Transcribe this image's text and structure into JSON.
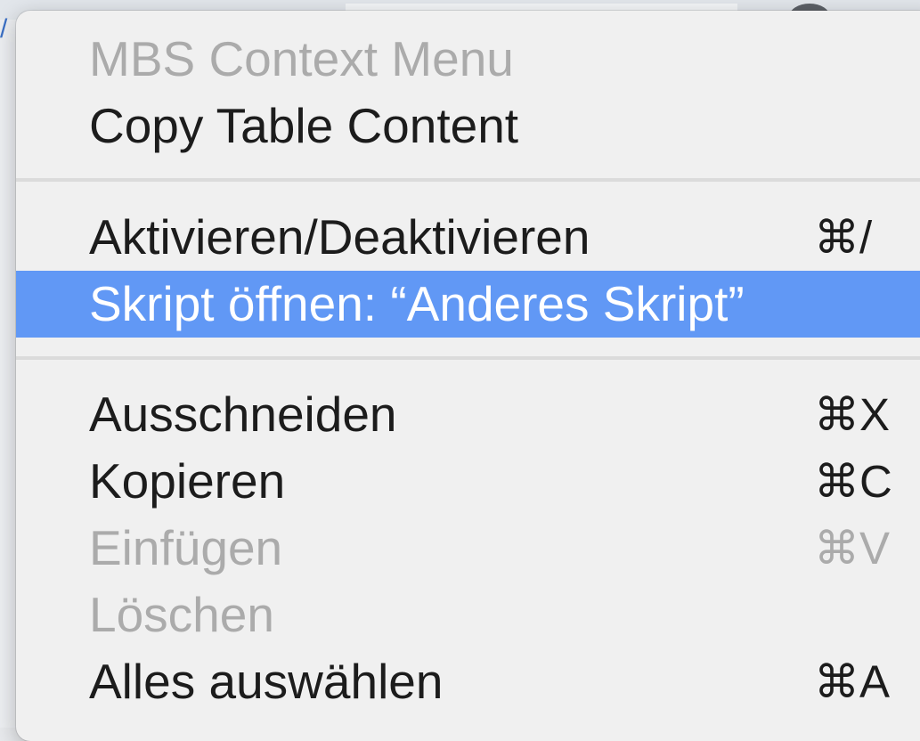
{
  "menu": {
    "header_label": "MBS Context Menu",
    "items": [
      {
        "label": "Copy Table Content",
        "shortcut": "",
        "enabled": true
      },
      {
        "label": "Aktivieren/Deaktivieren",
        "shortcut": "⌘/",
        "enabled": true
      },
      {
        "label": "Skript öffnen:  “Anderes Skript”",
        "shortcut": "",
        "enabled": true,
        "highlighted": true
      },
      {
        "label": "Ausschneiden",
        "shortcut": "⌘X",
        "enabled": true
      },
      {
        "label": "Kopieren",
        "shortcut": "⌘C",
        "enabled": true
      },
      {
        "label": "Einfügen",
        "shortcut": "⌘V",
        "enabled": false
      },
      {
        "label": "Löschen",
        "shortcut": "",
        "enabled": false
      },
      {
        "label": "Alles auswählen",
        "shortcut": "⌘A",
        "enabled": true
      }
    ]
  },
  "colors": {
    "menu_background": "#f0f0f0",
    "highlight": "#6198f5",
    "text": "#1c1c1c",
    "disabled_text": "#ababab"
  }
}
